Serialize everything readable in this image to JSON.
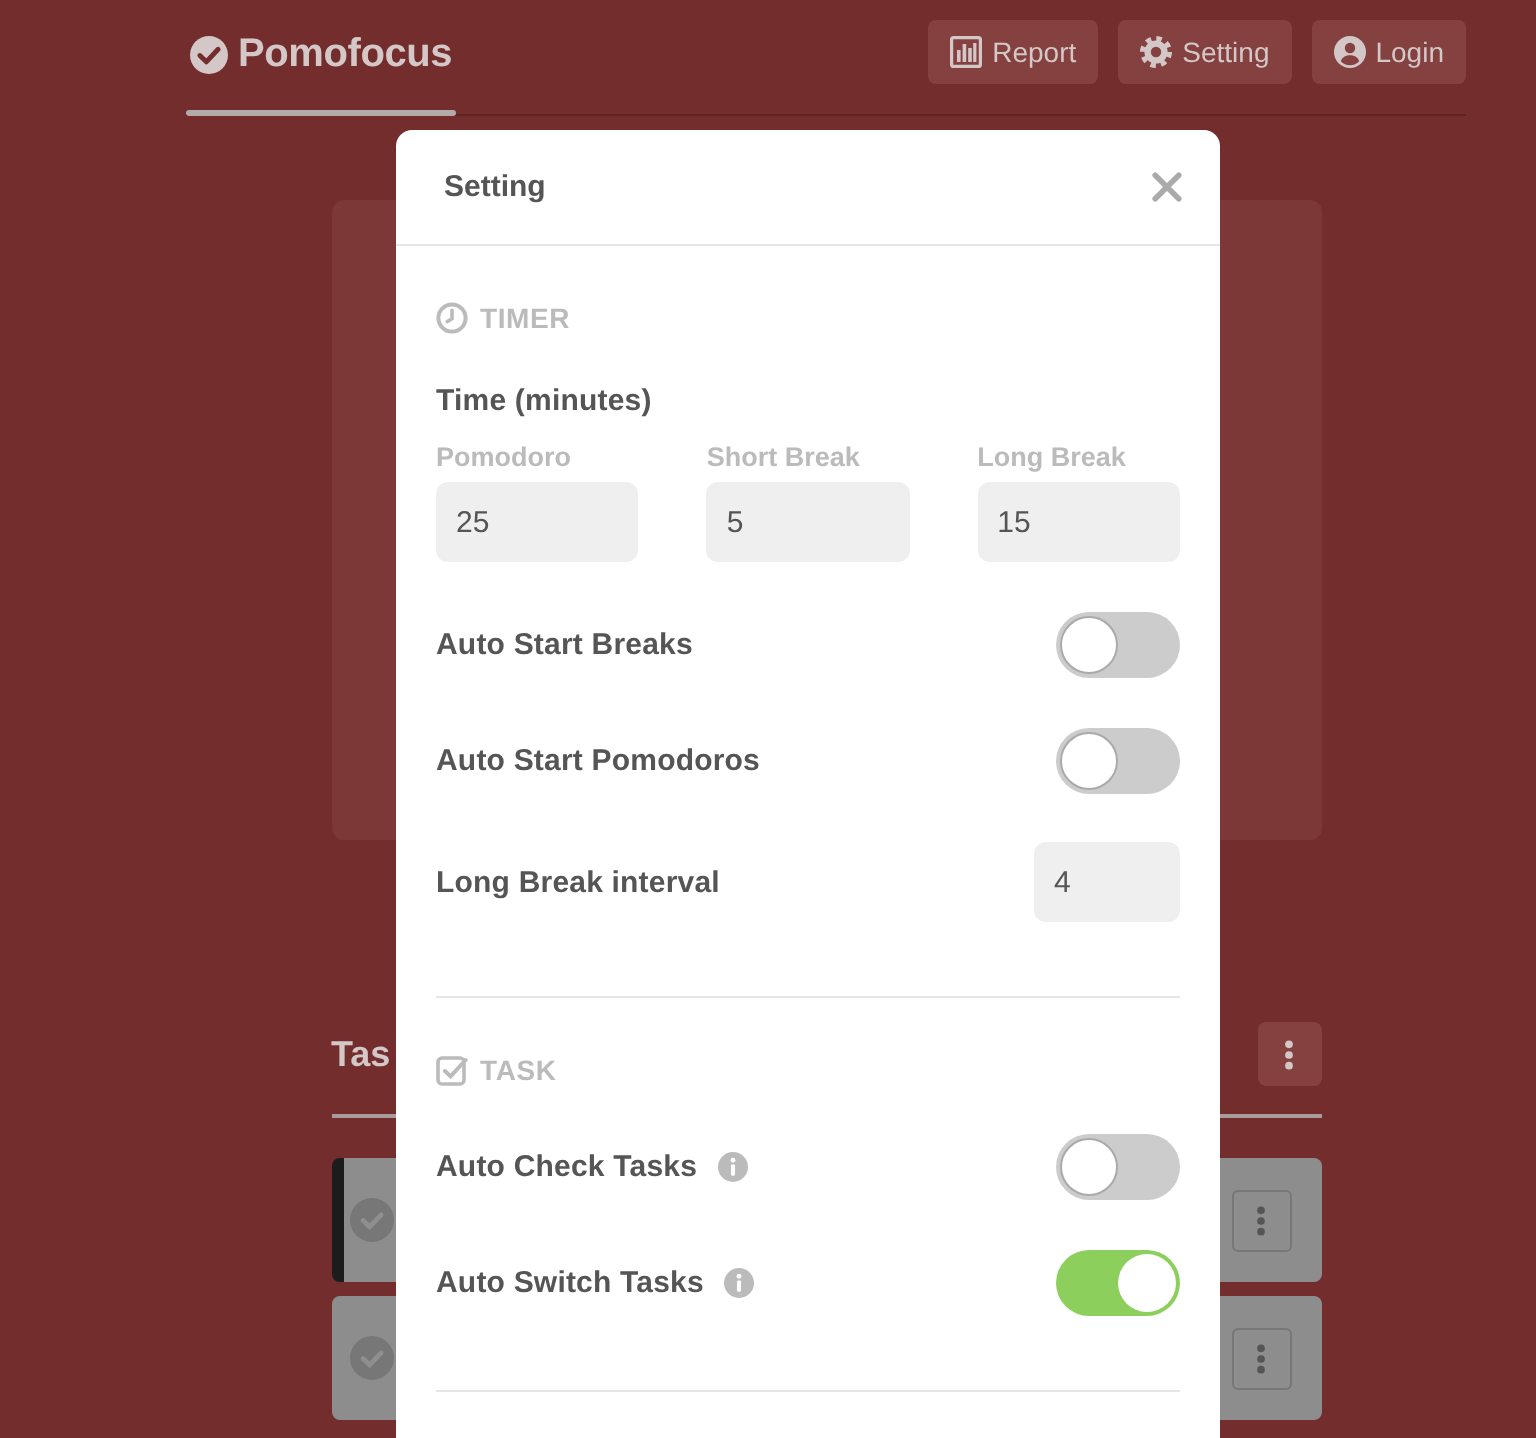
{
  "header": {
    "logo": "Pomofocus",
    "nav": [
      {
        "label": "Report"
      },
      {
        "label": "Setting"
      },
      {
        "label": "Login"
      }
    ]
  },
  "tasks": {
    "title": "Tas",
    "rows": [
      {
        "active": true
      },
      {
        "active": false
      }
    ]
  },
  "settings": {
    "title": "Setting",
    "sections": [
      {
        "kind": "timer",
        "heading": "TIMER",
        "items": [
          {
            "kind": "durations",
            "label": "Time (minutes)",
            "fields": [
              {
                "label": "Pomodoro",
                "value": "25"
              },
              {
                "label": "Short Break",
                "value": "5"
              },
              {
                "label": "Long Break",
                "value": "15"
              }
            ]
          },
          {
            "kind": "toggle",
            "label": "Auto Start Breaks",
            "on": false,
            "info": false
          },
          {
            "kind": "toggle",
            "label": "Auto Start Pomodoros",
            "on": false,
            "info": false
          },
          {
            "kind": "number",
            "label": "Long Break interval",
            "value": "4"
          }
        ]
      },
      {
        "kind": "task",
        "heading": "TASK",
        "items": [
          {
            "kind": "toggle",
            "label": "Auto Check Tasks",
            "on": false,
            "info": true
          },
          {
            "kind": "toggle",
            "label": "Auto Switch Tasks",
            "on": true,
            "info": true
          }
        ]
      }
    ]
  }
}
